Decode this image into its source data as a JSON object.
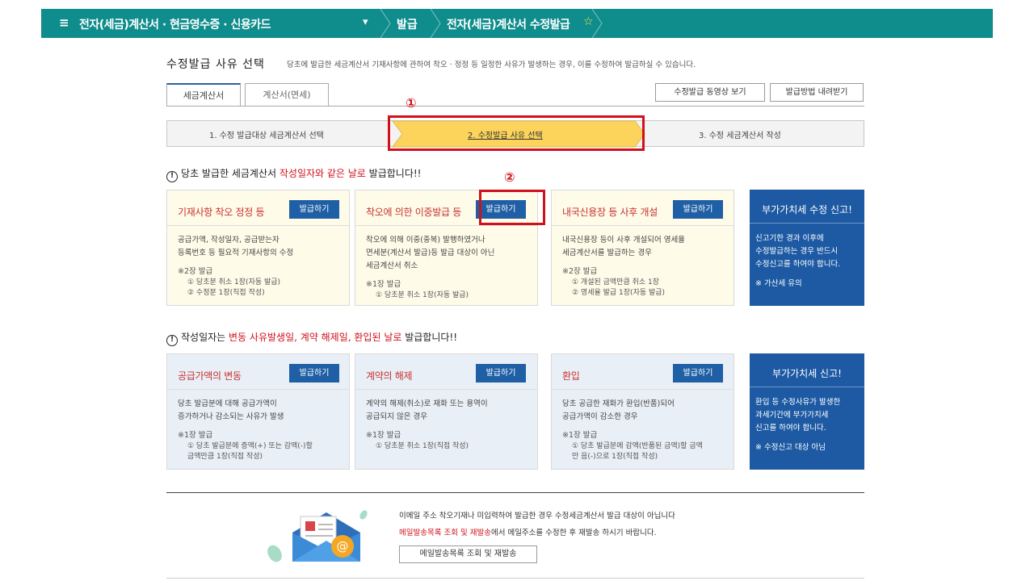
{
  "topbar": {
    "menu_icon": "≡",
    "crumb1": "전자(세금)계산서 · 현금영수증 · 신용카드",
    "crumb2": "발급",
    "crumb3": "전자(세금)계산서 수정발급",
    "star": "☆"
  },
  "heading": {
    "title": "수정발급 사유 선택",
    "desc": "당초에 발급한 세금계산서 기재사항에 관하여 착오 · 정정 등 일정한 사유가 발생하는 경우, 이를 수정하여 발급하실 수 있습니다."
  },
  "tabs": [
    "세금계산서",
    "계산서(면세)"
  ],
  "buttons": {
    "video": "수정발급 동영상 보기",
    "download": "발급방법 내려받기"
  },
  "steps": [
    "1. 수정 발급대상 세금계산서 선택",
    "2. 수정발급 사유 선택",
    "3. 수정 세금계산서 작성"
  ],
  "markers": [
    "①",
    "②"
  ],
  "section1": {
    "prefix": "당초 발급한 세금계산서 ",
    "highlight": "작성일자와 같은 날로",
    "suffix": " 발급합니다!!"
  },
  "section2": {
    "prefix": "작성일자는 ",
    "highlight": "변동 사유발생일, 계약 해제일, 환입된 날로",
    "suffix": " 발급합니다!!"
  },
  "issue_label": "발급하기",
  "cards1": [
    {
      "title": "기재사항 착오 정정 등",
      "desc": [
        "공급가액, 작성일자, 공급받는자",
        "등록번호 등 필요적 기재사항의 수정"
      ],
      "note": "※2장 발급",
      "subs": [
        "① 당초분 취소 1장(자동 발급)",
        "② 수정분 1장(직접 작성)"
      ]
    },
    {
      "title": "착오에 의한 이중발급 등",
      "desc": [
        "착오에 의해 이중(중복) 발행하였거나",
        "면세분(계산서 발급)등 발급 대상이 아닌",
        "세금계산서 취소"
      ],
      "note": "※1장 발급",
      "subs": [
        "① 당초분 취소 1장(자동 발급)"
      ]
    },
    {
      "title": "내국신용장 등 사후 개설",
      "desc": [
        "내국신용장 등이 사후 개설되어 영세율",
        "세금계산서를 발급하는 경우"
      ],
      "note": "※2장 발급",
      "subs": [
        "① 개설된 금액만큼 취소 1장",
        "② 영세율 발급 1장(자동 발급)"
      ]
    }
  ],
  "dcard1": {
    "title": "부가가치세 수정 신고!",
    "desc": [
      "신고기한 경과 이후에",
      "수정발급하는 경우 반드시",
      "수정신고를 하여야 합니다."
    ],
    "warn": "※ 가산세 유의"
  },
  "cards2": [
    {
      "title": "공급가액의 변동",
      "desc": [
        "당초 발급분에 대해 공급가액이",
        "증가하거나 감소되는 사유가 발생"
      ],
      "note": "※1장 발급",
      "subs": [
        "① 당초 발급분에 증액(+) 또는 감액(-)할",
        "금액만큼 1장(직접 작성)"
      ]
    },
    {
      "title": "계약의 해제",
      "desc": [
        "계약의 해제(취소)로 재화 또는 용역이",
        "공급되지 않은 경우"
      ],
      "note": "※1장 발급",
      "subs": [
        "① 당초분 취소 1장(직접 작성)"
      ]
    },
    {
      "title": "환입",
      "desc": [
        "당초 공급한 재화가 환입(반품)되어",
        "공급가액이 감소한 경우"
      ],
      "note": "※1장 발급",
      "subs": [
        "① 당초 발급분에 감액(반품된 금액)할 금액",
        "만 음(-)으로 1장(직접 작성)"
      ]
    }
  ],
  "dcard2": {
    "title": "부가가치세 신고!",
    "desc": [
      "환입 등 수정사유가 발생한",
      "과세기간에 부가가치세",
      "신고를 하여야 합니다."
    ],
    "warn": "※ 수정신고 대상 아님"
  },
  "footer": {
    "line1": "이메일 주소 착오기재나 미입력하여 발급한 경우 수정세금계산서 발급 대상이 아닙니다",
    "line2_link": "메일발송목록 조회 및 재발송",
    "line2_rest": "에서 메일주소를 수정한 후 재발송 하시기 바랍니다.",
    "button": "메일발송목록 조회 및 재발송"
  },
  "colors": {
    "topbar": "#0f8c8c",
    "card_button": "#1f5fa5",
    "dark_card": "#1d5aa3",
    "highlight_red": "#d0111b",
    "step_active": "#fcd45c"
  }
}
